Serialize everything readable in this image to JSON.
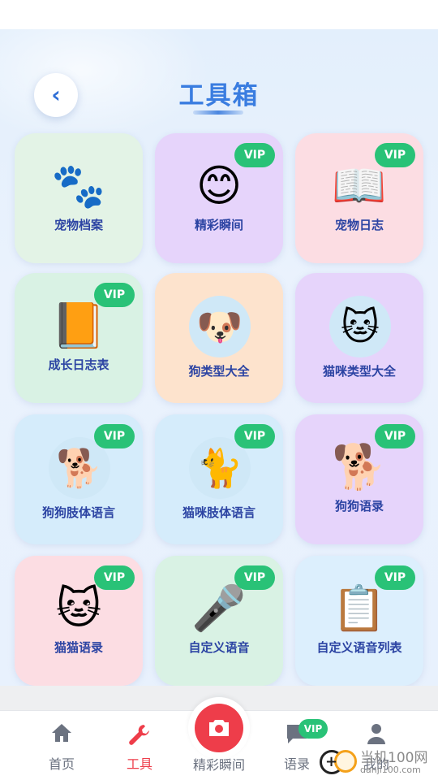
{
  "header": {
    "back_icon": "‹",
    "title": "工具箱"
  },
  "tools": [
    {
      "label": "宠物档案",
      "icon": "🐾",
      "icon_name": "paw-prints-icon",
      "vip": "",
      "bg": "#e3f3e6"
    },
    {
      "label": "精彩瞬间",
      "icon": "😊",
      "icon_name": "smiling-face-icon",
      "vip": "VIP",
      "bg": "#e6d4fb"
    },
    {
      "label": "宠物日志",
      "icon": "📖",
      "icon_name": "open-book-icon",
      "vip": "VIP",
      "bg": "#fcdde3"
    },
    {
      "label": "成长日志表",
      "icon": "📙",
      "icon_name": "orange-book-icon",
      "vip": "VIP",
      "bg": "#d9f2e4"
    },
    {
      "label": "狗类型大全",
      "icon": "🐶",
      "icon_name": "puppy-avatar-icon",
      "vip": "",
      "bg": "#fde3cd"
    },
    {
      "label": "猫咪类型大全",
      "icon": "🐱",
      "icon_name": "kitten-avatar-icon",
      "vip": "",
      "bg": "#e6d4fb"
    },
    {
      "label": "狗狗肢体语言",
      "icon": "🐕",
      "icon_name": "golden-retriever-photo-icon",
      "vip": "VIP",
      "bg": "#d5ecfb"
    },
    {
      "label": "猫咪肢体语言",
      "icon": "🐈",
      "icon_name": "cat-photo-icon",
      "vip": "VIP",
      "bg": "#d5ecfb"
    },
    {
      "label": "狗狗语录",
      "icon": "🐕",
      "icon_name": "dog-icon",
      "vip": "VIP",
      "bg": "#e6d4fb"
    },
    {
      "label": "猫猫语录",
      "icon": "🐱",
      "icon_name": "cat-face-icon",
      "vip": "VIP",
      "bg": "#fcdde3"
    },
    {
      "label": "自定义语音",
      "icon": "🎤",
      "icon_name": "microphone-icon",
      "vip": "VIP",
      "bg": "#d9f2e4"
    },
    {
      "label": "自定义语音列表",
      "icon": "📋",
      "icon_name": "clipboard-icon",
      "vip": "VIP",
      "bg": "#dceffd"
    }
  ],
  "tabbar": {
    "home": {
      "label": "首页",
      "icon": "⌂"
    },
    "tools": {
      "label": "工具",
      "icon": "🔧"
    },
    "moments": {
      "label": "精彩瞬间",
      "icon": "📷"
    },
    "quotes": {
      "label": "语录",
      "icon": "💬",
      "badge": "VIP"
    },
    "mine": {
      "label": "我的",
      "icon": "👤"
    }
  },
  "watermark": {
    "line1": "当机100网",
    "line2": "danji100.com"
  },
  "colors": {
    "accent": "#ee3d4a",
    "vip": "#29c277",
    "title": "#3a7de0",
    "label": "#2c44a3"
  }
}
